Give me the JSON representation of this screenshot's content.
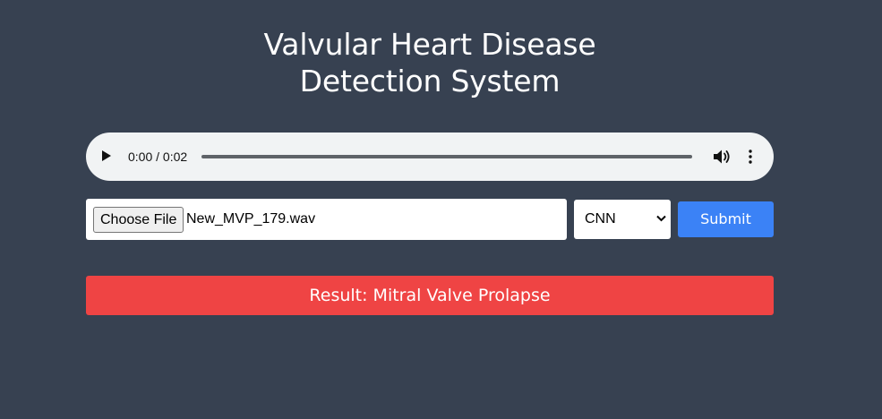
{
  "page": {
    "title_line1": "Valvular Heart Disease",
    "title_line2": "Detection System",
    "background_color": "#374151"
  },
  "audio_player": {
    "time_display": "0:00 / 0:02",
    "current_time": "0:00",
    "duration": "0:02",
    "progress": 0,
    "play_icon": "play-icon",
    "volume_icon": "volume-icon",
    "more_icon": "more-options-icon"
  },
  "upload_form": {
    "choose_file_label": "Choose File",
    "selected_file_name": "New_MVP_179.wav",
    "model_select": {
      "selected": "CNN",
      "icon": "chevron-down-icon"
    },
    "submit_label": "Submit",
    "submit_color": "#3b82f6"
  },
  "result": {
    "text": "Result: Mitral Valve Prolapse",
    "color": "#ef4444"
  }
}
